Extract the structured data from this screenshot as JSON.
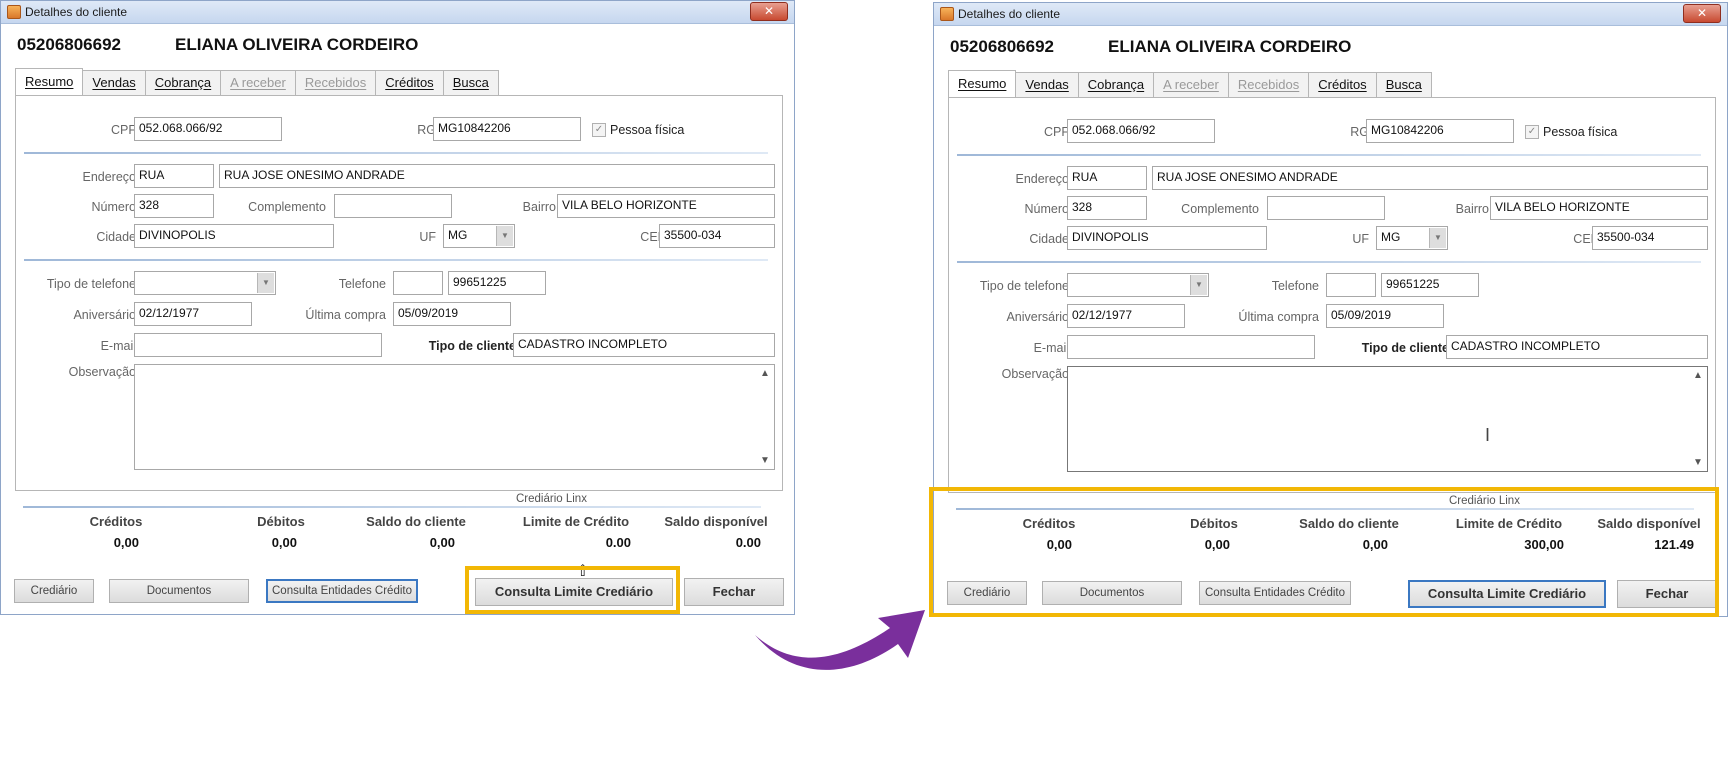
{
  "windows": [
    {
      "title": "Detalhes do cliente",
      "close_label": "✕",
      "code": "05206806692",
      "name": "ELIANA OLIVEIRA CORDEIRO",
      "tabs": [
        {
          "label": "Resumo",
          "state": "active"
        },
        {
          "label": "Vendas",
          "state": "normal"
        },
        {
          "label": "Cobrança",
          "state": "normal"
        },
        {
          "label": "A receber",
          "state": "disabled"
        },
        {
          "label": "Recebidos",
          "state": "disabled"
        },
        {
          "label": "Créditos",
          "state": "normal"
        },
        {
          "label": "Busca",
          "state": "normal"
        }
      ],
      "labels": {
        "cpf": "CPF",
        "rg": "RG",
        "pessoa": "Pessoa física",
        "endereco": "Endereço",
        "numero": "Número",
        "complemento": "Complemento",
        "bairro": "Bairro",
        "cidade": "Cidade",
        "uf": "UF",
        "cep": "CEP",
        "tipo_telefone": "Tipo de telefone",
        "telefone": "Telefone",
        "aniversario": "Aniversário",
        "ultima_compra": "Última compra",
        "email": "E-mail",
        "tipo_cliente": "Tipo de cliente",
        "observacao": "Observação"
      },
      "fields": {
        "cpf": "052.068.066/92",
        "rg": "MG10842206",
        "endereco_tipo": "RUA",
        "endereco": "RUA JOSE ONESIMO ANDRADE",
        "numero": "328",
        "complemento": "",
        "bairro": "VILA BELO HORIZONTE",
        "cidade": "DIVINOPOLIS",
        "uf": "MG",
        "cep": "35500-034",
        "tipo_telefone": "",
        "ddd": "",
        "telefone": "99651225",
        "aniversario": "02/12/1977",
        "ultima_compra": "05/09/2019",
        "email": "",
        "tipo_cliente": "CADASTRO INCOMPLETO",
        "observacao": ""
      },
      "summary": {
        "section_label": "Crediário Linx",
        "headers": [
          "Créditos",
          "Débitos",
          "Saldo do cliente",
          "Limite de Crédito",
          "Saldo disponível"
        ],
        "values": [
          "0,00",
          "0,00",
          "0,00",
          "0.00",
          "0.00"
        ]
      },
      "buttons": {
        "crediario": "Crediário",
        "documentos": "Documentos",
        "consulta_entidades": "Consulta Entidades Crédito",
        "consulta_limite": "Consulta Limite Crediário",
        "fechar": "Fechar"
      }
    },
    {
      "title": "Detalhes do cliente",
      "close_label": "✕",
      "code": "05206806692",
      "name": "ELIANA OLIVEIRA CORDEIRO",
      "tabs": [
        {
          "label": "Resumo",
          "state": "active"
        },
        {
          "label": "Vendas",
          "state": "normal"
        },
        {
          "label": "Cobrança",
          "state": "normal"
        },
        {
          "label": "A receber",
          "state": "disabled"
        },
        {
          "label": "Recebidos",
          "state": "disabled"
        },
        {
          "label": "Créditos",
          "state": "normal"
        },
        {
          "label": "Busca",
          "state": "normal"
        }
      ],
      "labels": {
        "cpf": "CPF",
        "rg": "RG",
        "pessoa": "Pessoa física",
        "endereco": "Endereço",
        "numero": "Número",
        "complemento": "Complemento",
        "bairro": "Bairro",
        "cidade": "Cidade",
        "uf": "UF",
        "cep": "CEP",
        "tipo_telefone": "Tipo de telefone",
        "telefone": "Telefone",
        "aniversario": "Aniversário",
        "ultima_compra": "Última compra",
        "email": "E-mail",
        "tipo_cliente": "Tipo de cliente",
        "observacao": "Observação"
      },
      "fields": {
        "cpf": "052.068.066/92",
        "rg": "MG10842206",
        "endereco_tipo": "RUA",
        "endereco": "RUA JOSE ONESIMO ANDRADE",
        "numero": "328",
        "complemento": "",
        "bairro": "VILA BELO HORIZONTE",
        "cidade": "DIVINOPOLIS",
        "uf": "MG",
        "cep": "35500-034",
        "tipo_telefone": "",
        "ddd": "",
        "telefone": "99651225",
        "aniversario": "02/12/1977",
        "ultima_compra": "05/09/2019",
        "email": "",
        "tipo_cliente": "CADASTRO INCOMPLETO",
        "observacao": ""
      },
      "summary": {
        "section_label": "Crediário Linx",
        "headers": [
          "Créditos",
          "Débitos",
          "Saldo do cliente",
          "Limite de Crédito",
          "Saldo disponível"
        ],
        "values": [
          "0,00",
          "0,00",
          "0,00",
          "300,00",
          "121.49"
        ]
      },
      "buttons": {
        "crediario": "Crediário",
        "documentos": "Documentos",
        "consulta_entidades": "Consulta Entidades Crédito",
        "consulta_limite": "Consulta Limite Crediário",
        "fechar": "Fechar"
      }
    }
  ],
  "colors": {
    "highlight": "#f2b705",
    "arrow": "#7a2f9c",
    "primary_button_border": "#3b78c2"
  }
}
